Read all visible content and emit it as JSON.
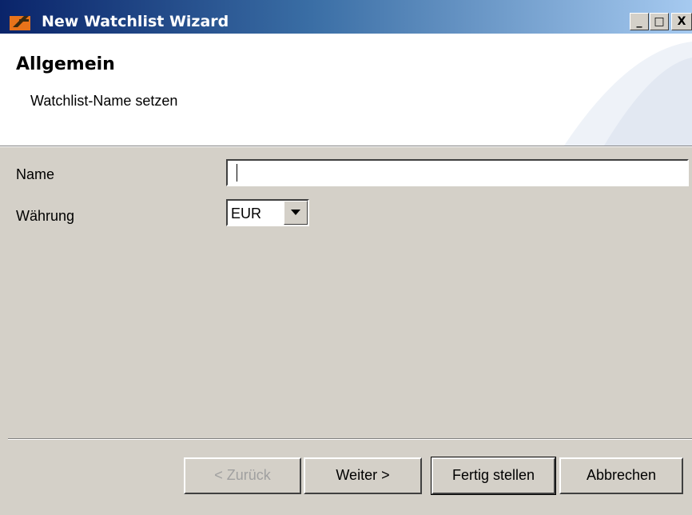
{
  "window": {
    "title": "New Watchlist Wizard",
    "controls": {
      "minimize": "_",
      "maximize": "□",
      "close": "X"
    }
  },
  "header": {
    "title": "Allgemein",
    "subtitle": "Watchlist-Name setzen"
  },
  "form": {
    "name_label": "Name",
    "name_value": "",
    "currency_label": "Währung",
    "currency_value": "EUR"
  },
  "buttons": {
    "back": "< Zurück",
    "next": "Weiter >",
    "finish": "Fertig stellen",
    "cancel": "Abbrechen"
  },
  "colors": {
    "titlebar_start": "#0a246a",
    "titlebar_end": "#a6caf0",
    "dialog_bg": "#d4d0c8"
  },
  "icons": {
    "app": "app-logo-icon",
    "dropdown": "chevron-down-icon"
  }
}
